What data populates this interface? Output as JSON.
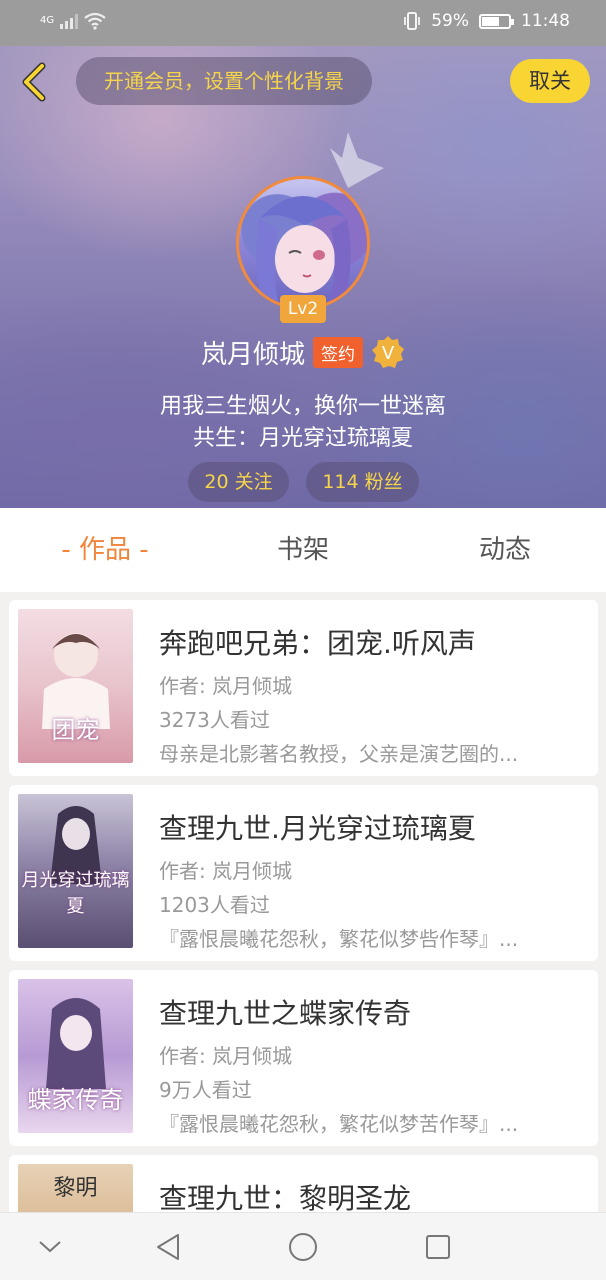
{
  "status_bar": {
    "network": "4G",
    "battery": "59%",
    "battery_level": 0.59,
    "time": "11:48"
  },
  "header": {
    "vip_prompt": "开通会员，设置个性化背景",
    "cancel_label": "取关"
  },
  "profile": {
    "level": "Lv2",
    "username": "岚月倾城",
    "contract_tag": "签约",
    "verified_letter": "V",
    "signature_line1": "用我三生烟火，换你一世迷离",
    "signature_line2": "共生：月光穿过琉璃夏",
    "following": "20 关注",
    "fans": "114 粉丝"
  },
  "tabs": [
    {
      "label": "- 作品 -",
      "active": true
    },
    {
      "label": "书架",
      "active": false
    },
    {
      "label": "动态",
      "active": false
    }
  ],
  "books": [
    {
      "title": "奔跑吧兄弟：团宠.听风声",
      "author": "作者: 岚月倾城",
      "views": "3273人看过",
      "desc": "母亲是北影著名教授，父亲是演艺圈的...",
      "cover_text": "团宠"
    },
    {
      "title": "查理九世.月光穿过琉璃夏",
      "author": "作者: 岚月倾城",
      "views": "1203人看过",
      "desc": "『露恨晨曦花怨秋，繁花似梦呰作琴』...",
      "cover_text": "月光穿过琉璃夏"
    },
    {
      "title": "查理九世之蝶家传奇",
      "author": "作者: 岚月倾城",
      "views": "9万人看过",
      "desc": "『露恨晨曦花怨秋，繁花似梦苦作琴』...",
      "cover_text": "蝶家传奇"
    },
    {
      "title": "查理九世：黎明圣龙",
      "author": "",
      "views": "",
      "desc": "",
      "cover_text": "黎明"
    }
  ],
  "colors": {
    "accent": "#f0853c",
    "yellow": "#f9d533",
    "contract_red": "#f0612e"
  },
  "icons": [
    "back-arrow-icon",
    "crown-icon",
    "verified-v-icon",
    "nav-collapse-icon",
    "nav-back-icon",
    "nav-home-icon",
    "nav-recents-icon"
  ]
}
